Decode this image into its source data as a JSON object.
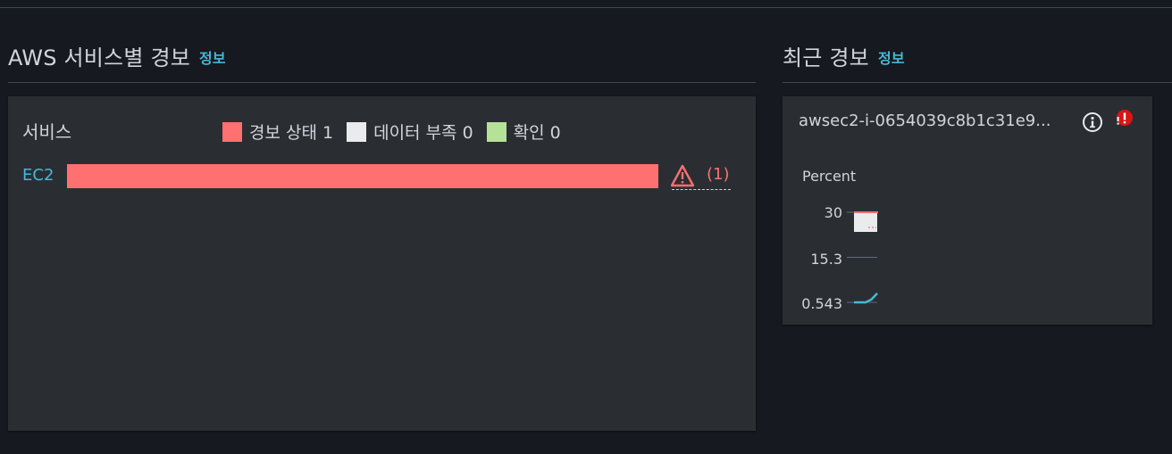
{
  "services_section": {
    "title": "AWS 서비스별 경보",
    "info_link": "정보",
    "column_header": "서비스",
    "legend": [
      {
        "label": "경보 상태 1",
        "color": "#ff7070"
      },
      {
        "label": "데이터 부족 0",
        "color": "#e9ebed"
      },
      {
        "label": "확인 0",
        "color": "#b5e296"
      }
    ],
    "rows": [
      {
        "service": "EC2",
        "alarm_fraction": 1.0,
        "warning_count": "(1)"
      }
    ]
  },
  "recent_section": {
    "title": "최근 경보",
    "info_link": "정보",
    "card": {
      "title": "awsec2-i-0654039c8b1c31e9...",
      "icons": [
        "info-icon",
        "alarm-icon"
      ],
      "chart_data": {
        "type": "line",
        "ylabel": "Percent",
        "y_ticks": [
          "30",
          "15.3",
          "0.543"
        ],
        "threshold": 30,
        "ylim": [
          0.543,
          30
        ],
        "series": [
          {
            "values": [
              0.543,
              0.543,
              0.543,
              1.5,
              3.5
            ]
          }
        ]
      }
    }
  },
  "colors": {
    "accent": "#44b9d6",
    "alarm": "#ff7070",
    "alarm_badge": "#d91515"
  }
}
